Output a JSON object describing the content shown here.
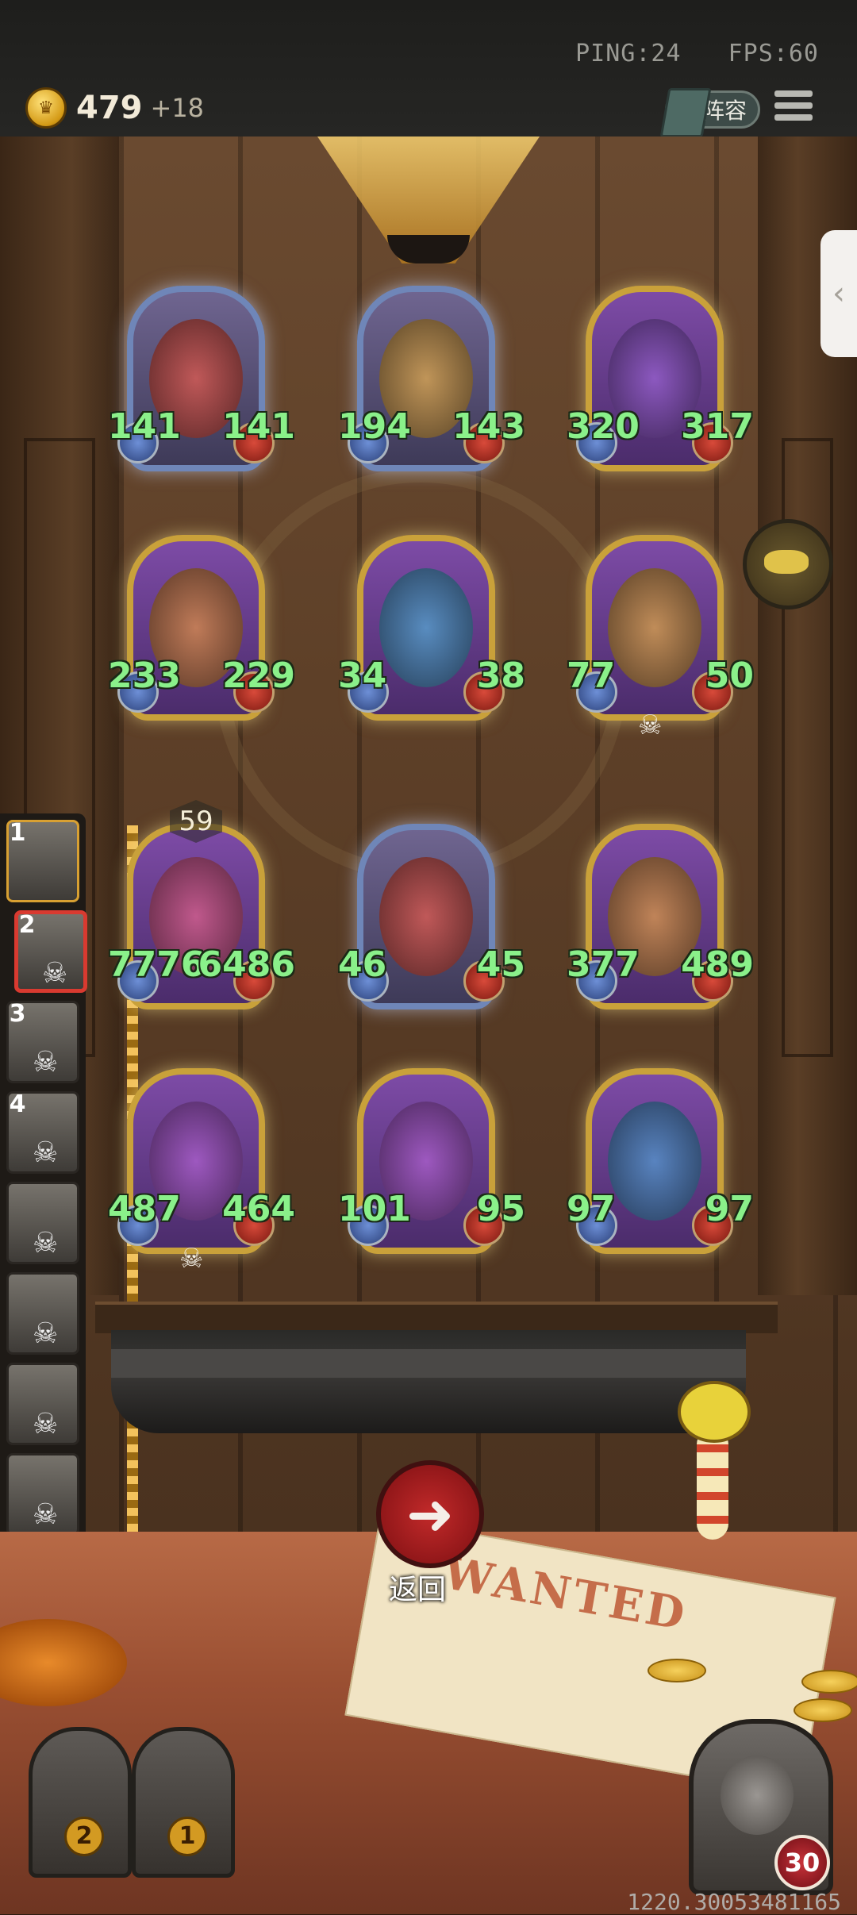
{
  "top": {
    "ping": "PING:24",
    "fps": "FPS:60"
  },
  "hud": {
    "gold": "479",
    "gold_income": "+18",
    "lineup_label": "阵容"
  },
  "board": [
    {
      "atk": "141",
      "hp": "141",
      "frame": "blue",
      "skull": false,
      "level": ""
    },
    {
      "atk": "194",
      "hp": "143",
      "frame": "blue",
      "skull": false,
      "level": ""
    },
    {
      "atk": "320",
      "hp": "317",
      "frame": "gold",
      "skull": false,
      "level": ""
    },
    {
      "atk": "233",
      "hp": "229",
      "frame": "gold",
      "skull": false,
      "level": ""
    },
    {
      "atk": "34",
      "hp": "38",
      "frame": "gold",
      "skull": false,
      "level": ""
    },
    {
      "atk": "77",
      "hp": "50",
      "frame": "gold",
      "skull": true,
      "level": ""
    },
    {
      "atk": "7776",
      "hp": "6486",
      "frame": "gold",
      "skull": false,
      "level": "59"
    },
    {
      "atk": "46",
      "hp": "45",
      "frame": "blue",
      "skull": false,
      "level": ""
    },
    {
      "atk": "377",
      "hp": "489",
      "frame": "gold",
      "skull": false,
      "level": ""
    },
    {
      "atk": "487",
      "hp": "464",
      "frame": "gold",
      "skull": true,
      "level": ""
    },
    {
      "atk": "101",
      "hp": "95",
      "frame": "gold",
      "skull": false,
      "level": ""
    },
    {
      "atk": "97",
      "hp": "97",
      "frame": "gold",
      "skull": false,
      "level": ""
    }
  ],
  "bench": [
    {
      "num": "1",
      "state": "active",
      "skull": false
    },
    {
      "num": "2",
      "state": "selected",
      "skull": true
    },
    {
      "num": "3",
      "state": "dead",
      "skull": true
    },
    {
      "num": "4",
      "state": "dead",
      "skull": true
    },
    {
      "num": "",
      "state": "dead",
      "skull": true
    },
    {
      "num": "",
      "state": "dead",
      "skull": true
    },
    {
      "num": "",
      "state": "dead",
      "skull": true
    },
    {
      "num": "",
      "state": "dead",
      "skull": true
    }
  ],
  "back_button": {
    "label": "返回"
  },
  "chests": [
    "2",
    "1"
  ],
  "player": {
    "hp": "30"
  },
  "version": "1220.30053481165",
  "colors": {
    "stat_green": "#8af08a",
    "gold_frame": "#c9a13a",
    "blue_frame": "#6f86b8",
    "back_red": "#c22a2a"
  },
  "icons": {
    "coin": "coin-icon",
    "menu": "menu-icon",
    "lineup": "book-icon",
    "back": "arrow-left-icon",
    "skull": "skull-icon",
    "side": "chevron-left-icon"
  }
}
